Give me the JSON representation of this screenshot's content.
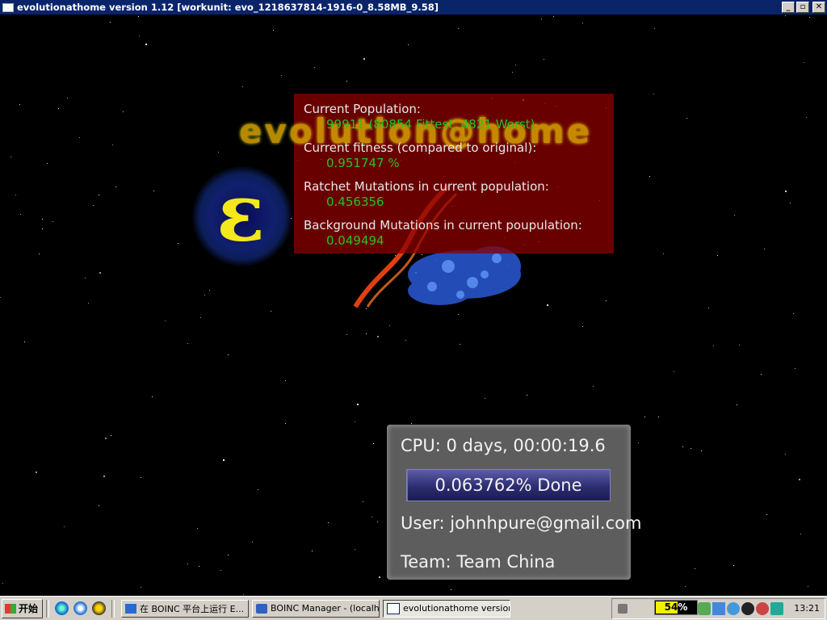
{
  "window": {
    "title": "evolutionathome version 1.12 [workunit: evo_1218637814-1916-0_8.58MB_9.58]",
    "minimize": "_",
    "maximize": "▫",
    "close": "✕"
  },
  "logo": {
    "letter": "ε",
    "brand_text": "evolution@home"
  },
  "stats": {
    "population_label": "Current Population:",
    "population_value": "99911 (80854 Fittest, 4821 Worst)",
    "fitness_label": "Current fitness (compared to original):",
    "fitness_value": "0.951747 %",
    "ratchet_label": "Ratchet Mutations in current population:",
    "ratchet_value": "0.456356",
    "background_label": "Background Mutations in current poupulation:",
    "background_value": "0.049494"
  },
  "cpu_panel": {
    "cpu_line": "CPU: 0 days, 00:00:19.6",
    "progress_label": "0.063762% Done",
    "progress_fraction": 0.00063762,
    "user_line": "User:   johnhpure@gmail.com",
    "team_line": "Team: Team China"
  },
  "taskbar": {
    "start_label": "开始",
    "quick_launch": [
      "ie-icon",
      "media-player-icon",
      "qq-icon"
    ],
    "tasks": [
      {
        "label": "在 BOINC 平台上运行 E...",
        "icon": "ie-icon"
      },
      {
        "label": "BOINC Manager - (localh...",
        "icon": "boinc-icon"
      },
      {
        "label": "evolutionathome version...",
        "icon": "window-icon"
      }
    ],
    "meter_value": "54",
    "meter_unit": "%",
    "meter_fraction": 0.54,
    "clock": "13:21"
  },
  "colors": {
    "title_bar": "#0a246a",
    "stat_value": "#23c523",
    "stat_panel": "#8c0000",
    "logo_yellow": "#f4e81c"
  }
}
